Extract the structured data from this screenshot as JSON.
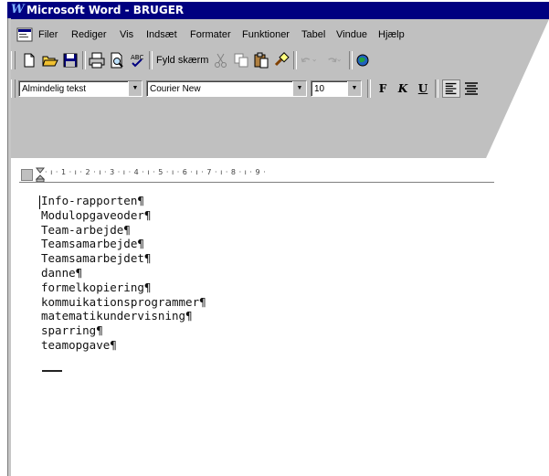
{
  "window": {
    "title": "Microsoft Word - BRUGER"
  },
  "menu": {
    "items": [
      "Filer",
      "Rediger",
      "Vis",
      "Indsæt",
      "Formater",
      "Funktioner",
      "Tabel",
      "Vindue",
      "Hjælp"
    ]
  },
  "standard_toolbar": {
    "fit_label": "Fyld skærm"
  },
  "formatting_toolbar": {
    "style": "Almindelig tekst",
    "font": "Courier New",
    "size": "10",
    "bold": "F",
    "italic": "K",
    "underline": "U"
  },
  "ruler": {
    "ticks": "· ı · 1 · ı · 2 · ı · 3 · ı · 4 · ı · 5 · ı · 6 · ı · 7 · ı · 8 · ı · 9 ·"
  },
  "document": {
    "lines": [
      "Info-rapporten¶",
      "Modulopgaveoder¶",
      "Team-arbejde¶",
      "Teamsamarbejde¶",
      "Teamsamarbejdet¶",
      "danne¶",
      "formelkopiering¶",
      "kommuikationsprogrammer¶",
      "matematikundervisning¶",
      "sparring¶",
      "teamopgave¶"
    ]
  },
  "colors": {
    "titlebar": "#000080",
    "chrome": "#c0c0c0"
  }
}
